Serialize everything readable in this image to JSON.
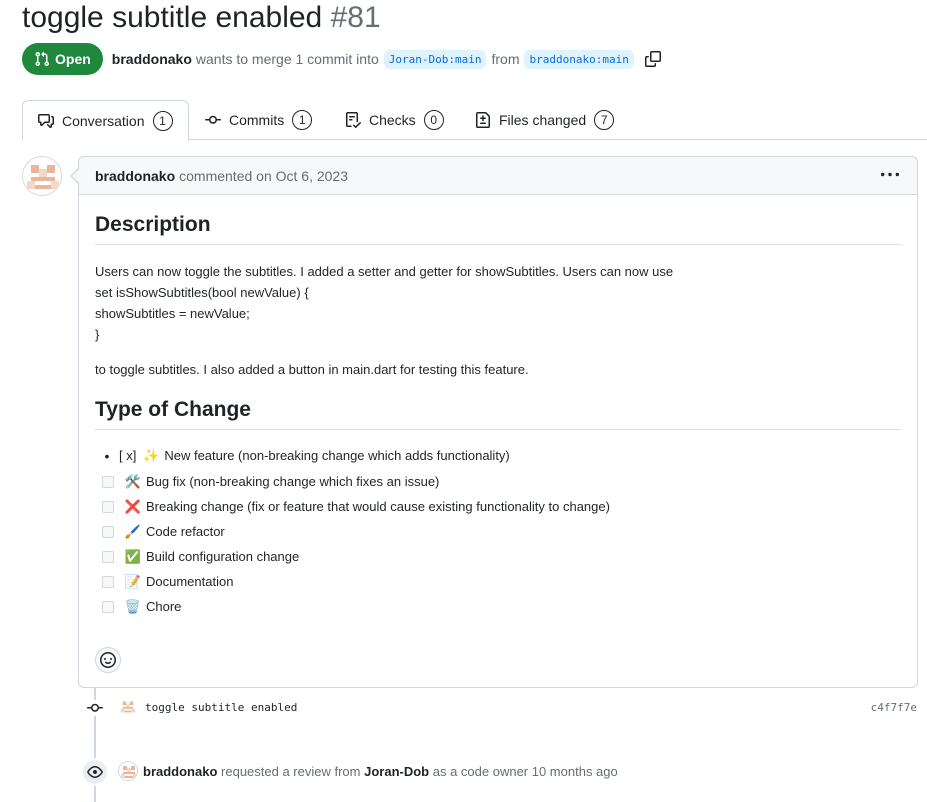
{
  "pr": {
    "title": "toggle subtitle enabled",
    "number": "#81",
    "state": "Open",
    "author": "braddonako",
    "merge_text": "wants to merge 1 commit into",
    "base_branch": "Joran-Dob:main",
    "from_text": "from",
    "head_branch": "braddonako:main"
  },
  "tabs": [
    {
      "label": "Conversation",
      "count": "1"
    },
    {
      "label": "Commits",
      "count": "1"
    },
    {
      "label": "Checks",
      "count": "0"
    },
    {
      "label": "Files changed",
      "count": "7"
    }
  ],
  "comment": {
    "author": "braddonako",
    "action": "commented on Oct 6, 2023",
    "h_description": "Description",
    "line1": "Users can now toggle the subtitles. I added a setter and getter for showSubtitles. Users can now use",
    "line2": "set isShowSubtitles(bool newValue) {",
    "line3": "showSubtitles = newValue;",
    "line4": "}",
    "para2": "to toggle subtitles. I also added a button in main.dart for testing this feature.",
    "h_type": "Type of Change",
    "first_item": {
      "prefix": "[ x]",
      "emoji": "✨",
      "text": "New feature (non-breaking change which adds functionality)"
    },
    "items": [
      {
        "emoji": "🛠️",
        "text": "Bug fix (non-breaking change which fixes an issue)"
      },
      {
        "emoji": "❌",
        "text": "Breaking change (fix or feature that would cause existing functionality to change)"
      },
      {
        "emoji": "🖌️",
        "text": "Code refactor"
      },
      {
        "emoji": "✅",
        "text": "Build configuration change"
      },
      {
        "emoji": "📝",
        "text": "Documentation"
      },
      {
        "emoji": "🗑️",
        "text": "Chore"
      }
    ]
  },
  "commit": {
    "message": "toggle subtitle enabled",
    "sha": "c4f7f7e"
  },
  "review": {
    "actor": "braddonako",
    "text1": "requested a review from",
    "reviewer": "Joran-Dob",
    "text2": "as a code owner 10 months ago"
  },
  "colors": {
    "open_green": "#1f883d",
    "link_blue": "#0969da",
    "branch_bg": "#ddf4ff",
    "border": "#d0d7de",
    "muted": "#656d76"
  }
}
